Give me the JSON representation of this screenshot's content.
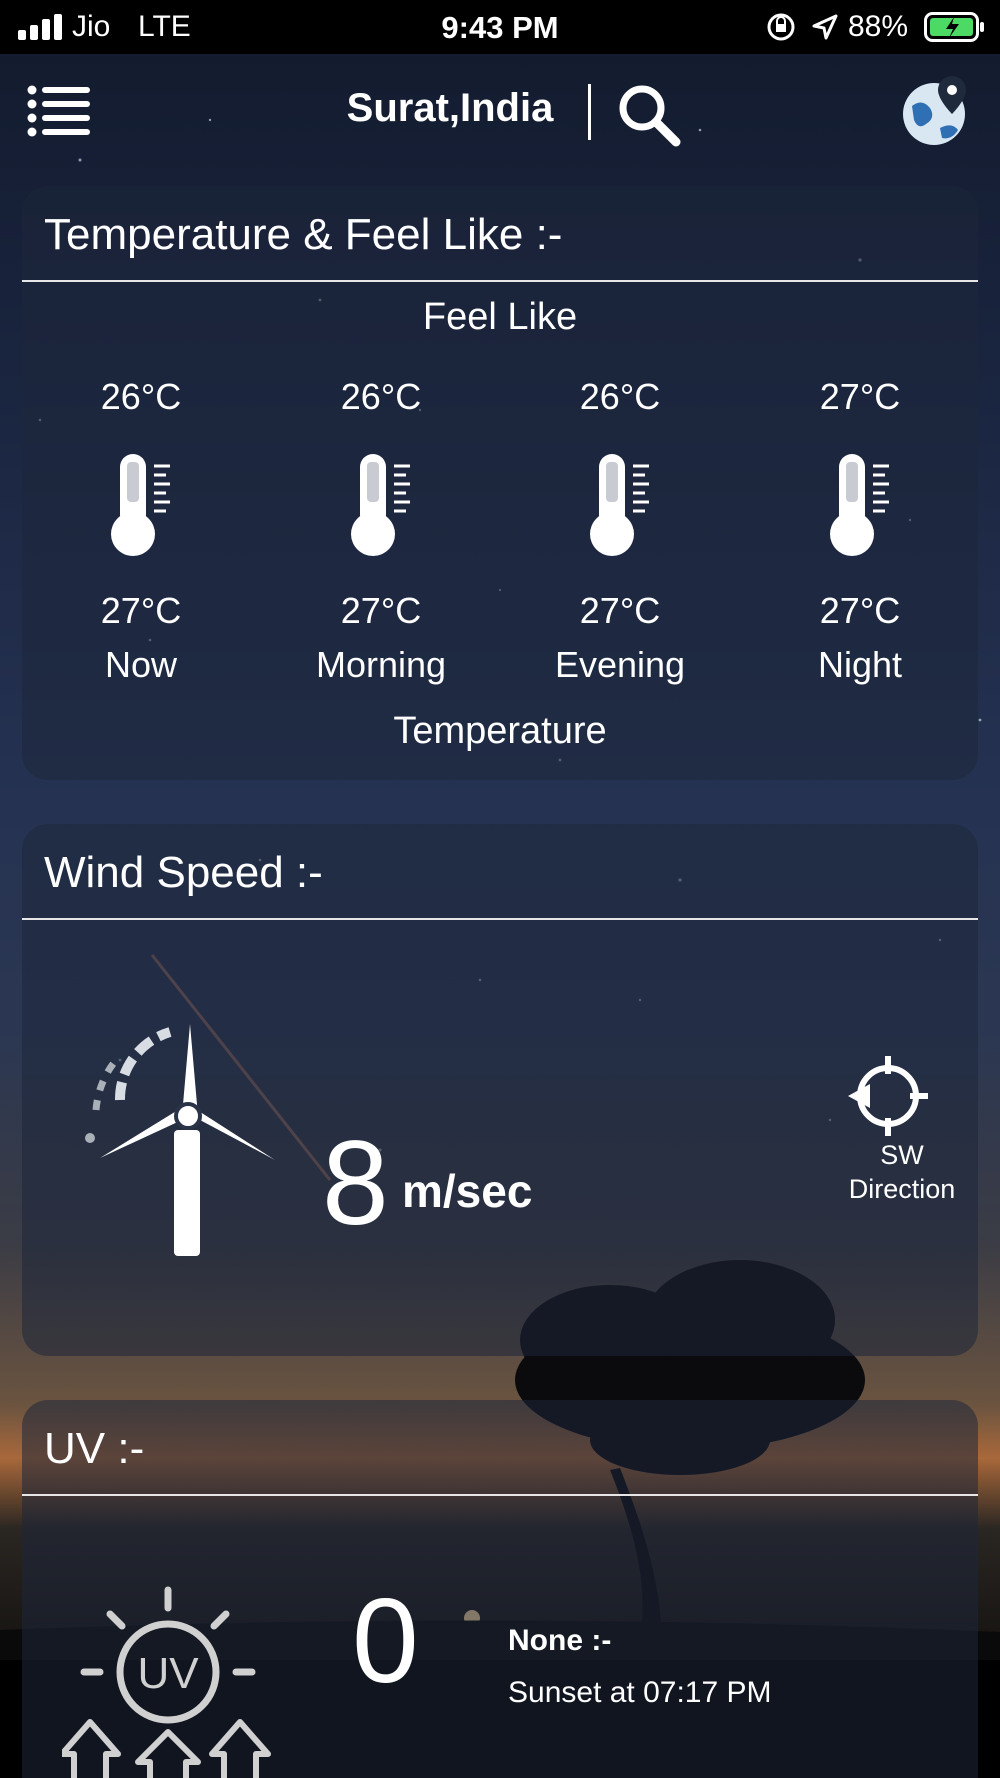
{
  "status_bar": {
    "carrier": "Jio",
    "network": "LTE",
    "time": "9:43 PM",
    "battery_percent": "88%",
    "icons": [
      "signal-icon",
      "rotation-lock-icon",
      "location-arrow-icon",
      "battery-charging-icon"
    ]
  },
  "header": {
    "location": "Surat,India",
    "icons": [
      "menu-icon",
      "search-icon",
      "globe-pin-icon"
    ]
  },
  "temperature_card": {
    "title": "Temperature & Feel Like :-",
    "feel_like_label": "Feel Like",
    "temperature_label": "Temperature",
    "columns": [
      {
        "feel_like": "26°C",
        "temperature": "27°C",
        "period": "Now"
      },
      {
        "feel_like": "26°C",
        "temperature": "27°C",
        "period": "Morning"
      },
      {
        "feel_like": "26°C",
        "temperature": "27°C",
        "period": "Evening"
      },
      {
        "feel_like": "27°C",
        "temperature": "27°C",
        "period": "Night"
      }
    ]
  },
  "wind_card": {
    "title": "Wind Speed :-",
    "speed": "8",
    "unit": "m/sec",
    "direction": "SW",
    "direction_label": "Direction"
  },
  "uv_card": {
    "title": "UV :-",
    "value": "0",
    "level": "None :-",
    "sunset": "Sunset at 07:17 PM"
  },
  "colors": {
    "status_bar": "#000000",
    "battery_fill": "#4cd964",
    "divider": "#e6e6e6"
  }
}
